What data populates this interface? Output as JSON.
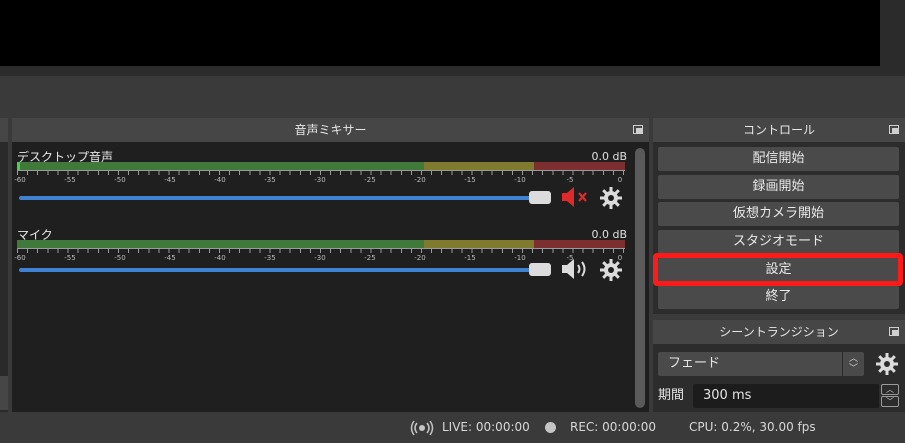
{
  "mixer": {
    "title": "音声ミキサー",
    "channels": [
      {
        "name": "デスクトップ音声",
        "db": "0.0 dB",
        "muted": true,
        "volume": 1.0
      },
      {
        "name": "マイク",
        "db": "0.0 dB",
        "muted": false,
        "volume": 1.0
      }
    ],
    "ticks": [
      "-60",
      "-55",
      "-50",
      "-45",
      "-40",
      "-35",
      "-30",
      "-25",
      "-20",
      "-15",
      "-10",
      "-5",
      "0"
    ]
  },
  "controls": {
    "title": "コントロール",
    "buttons": {
      "stream": "配信開始",
      "record": "録画開始",
      "virtualcam": "仮想カメラ開始",
      "studio": "スタジオモード",
      "settings": "設定",
      "exit": "終了"
    }
  },
  "transitions": {
    "title": "シーントランジション",
    "selected": "フェード",
    "duration_label": "期間",
    "duration_value": "300 ms"
  },
  "status": {
    "live": "LIVE: 00:00:00",
    "rec": "REC: 00:00:00",
    "cpu": "CPU: 0.2%, 30.00 fps"
  },
  "colors": {
    "highlight": "#ff1a1a",
    "slider": "#3f82d1",
    "muted_icon": "#e02a2a"
  }
}
